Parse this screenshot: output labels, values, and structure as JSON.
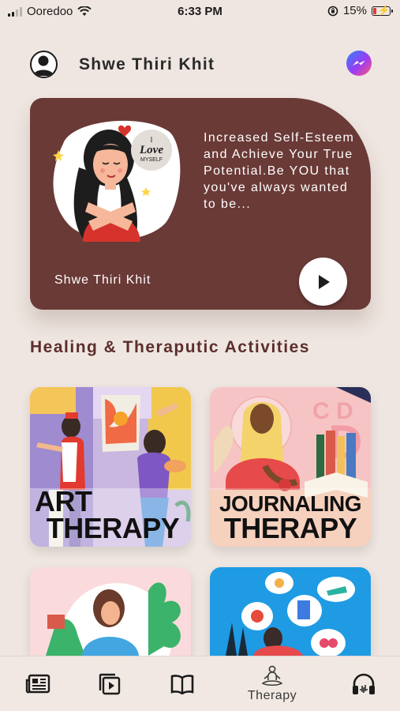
{
  "status_bar": {
    "carrier": "Ooredoo",
    "time": "6:33 PM",
    "battery": "15%"
  },
  "header": {
    "user_name": "Shwe Thiri Khit",
    "avatar_icon": "user-circle-icon",
    "messenger_icon": "messenger-icon"
  },
  "hero": {
    "badge_line1": "I",
    "badge_line2": "Love",
    "badge_line3": "MYSELF",
    "description": "Increased Self-Esteem and Achieve Your True Potential.Be YOU that you've always wanted to be...",
    "author": "Shwe Thiri Khit",
    "play_icon": "play-icon"
  },
  "section_title": "Healing & Theraputic Activities",
  "activities": [
    {
      "line1": "ART",
      "line2": "THERAPY"
    },
    {
      "line1": "JOURNALING",
      "line2": "THERAPY"
    },
    {
      "line1": "",
      "line2": ""
    },
    {
      "line1": "",
      "line2": ""
    }
  ],
  "bottom_nav": [
    {
      "icon": "news-icon",
      "label": ""
    },
    {
      "icon": "video-icon",
      "label": ""
    },
    {
      "icon": "book-icon",
      "label": ""
    },
    {
      "icon": "meditation-icon",
      "label": "Therapy",
      "active": true
    },
    {
      "icon": "headphones-icon",
      "label": ""
    }
  ],
  "colors": {
    "background": "#efe6e1",
    "hero": "#6a3a36",
    "title": "#5c2e2b"
  }
}
